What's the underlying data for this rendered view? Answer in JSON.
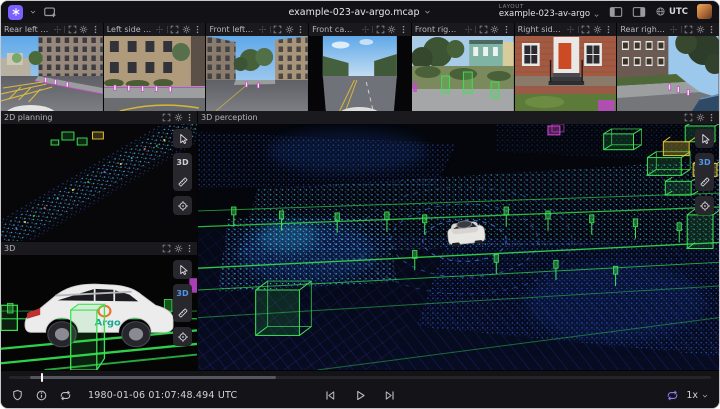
{
  "app_bar": {
    "title": "example-023-av-argo.mcap",
    "layout_label": "LAYOUT",
    "layout_name": "example-023-av-argo",
    "timezone_button": "UTC"
  },
  "camera_panels": [
    {
      "title": "Rear left camera"
    },
    {
      "title": "Left side camera"
    },
    {
      "title": "Front left camera"
    },
    {
      "title": "Front camera"
    },
    {
      "title": "Front right camera"
    },
    {
      "title": "Right side camera"
    },
    {
      "title": "Rear right camera"
    }
  ],
  "panels": {
    "planning": {
      "title": "2D planning"
    },
    "model3d": {
      "title": "3D"
    },
    "perception": {
      "title": "3D perception"
    }
  },
  "viewport_toolbar": {
    "mode_label": "3D"
  },
  "scene": {
    "car_logo": "Argo"
  },
  "playback": {
    "timestamp": "1980-01-06 01:07:48.494 UTC",
    "speed": "1x",
    "progress_percent": 4.5,
    "loaded_start_percent": 3,
    "loaded_end_percent": 38
  },
  "colors": {
    "accent_purple": "#7b61ff",
    "active_blue": "#4e98e8",
    "annotation_green": "#3fe455",
    "annotation_yellow": "#e6c838",
    "annotation_magenta": "#d84ad8",
    "point_blue": "#3567e6",
    "point_cyan": "#38c4ea"
  }
}
